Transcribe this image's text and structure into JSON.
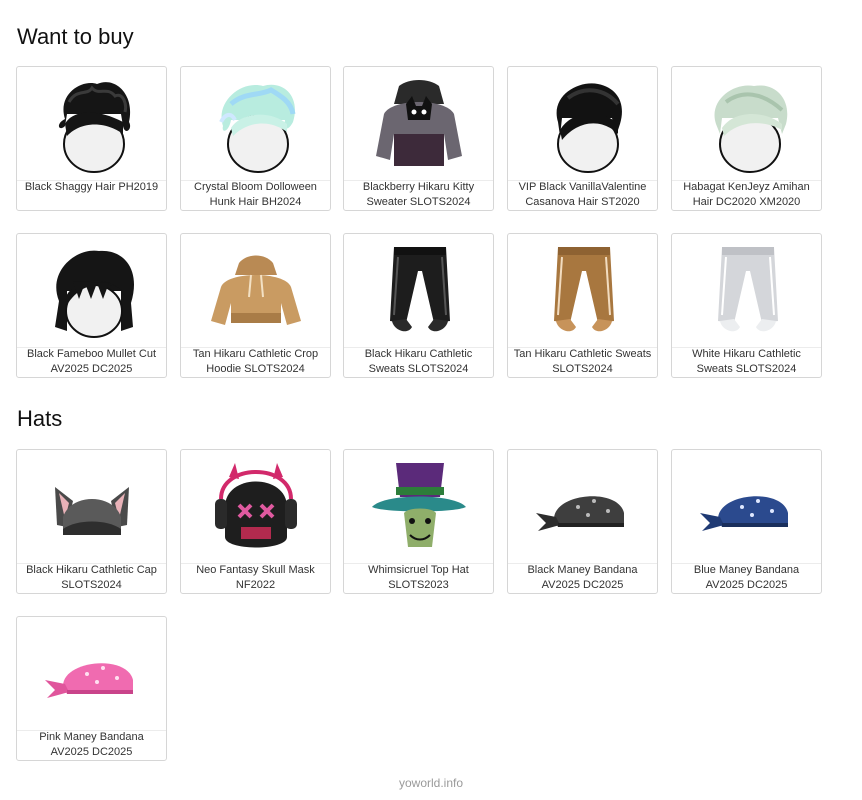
{
  "sections": [
    {
      "title": "Want to buy",
      "items": [
        {
          "name": "Black Shaggy Hair PH2019",
          "icon": "black-shaggy-hair-icon"
        },
        {
          "name": "Crystal Bloom Dolloween Hunk Hair BH2024",
          "icon": "crystal-bloom-hair-icon"
        },
        {
          "name": "Blackberry Hikaru Kitty Sweater SLOTS2024",
          "icon": "kitty-sweater-icon"
        },
        {
          "name": "VIP Black VanillaValentine Casanova Hair ST2020",
          "icon": "casanova-hair-icon"
        },
        {
          "name": "Habagat KenJeyz Amihan Hair DC2020 XM2020",
          "icon": "amihan-hair-icon"
        },
        {
          "name": "Black Fameboo Mullet Cut AV2025 DC2025",
          "icon": "mullet-hair-icon"
        },
        {
          "name": "Tan Hikaru Cathletic Crop Hoodie SLOTS2024",
          "icon": "crop-hoodie-icon"
        },
        {
          "name": "Black Hikaru Cathletic Sweats SLOTS2024",
          "icon": "black-sweats-icon"
        },
        {
          "name": "Tan Hikaru Cathletic Sweats SLOTS2024",
          "icon": "tan-sweats-icon"
        },
        {
          "name": "White Hikaru Cathletic Sweats SLOTS2024",
          "icon": "white-sweats-icon"
        }
      ]
    },
    {
      "title": "Hats",
      "items": [
        {
          "name": "Black Hikaru Cathletic Cap SLOTS2024",
          "icon": "cat-ear-cap-icon"
        },
        {
          "name": "Neo Fantasy Skull Mask NF2022",
          "icon": "skull-mask-icon"
        },
        {
          "name": "Whimsicruel Top Hat SLOTS2023",
          "icon": "top-hat-icon"
        },
        {
          "name": "Black Maney Bandana AV2025 DC2025",
          "icon": "black-bandana-icon"
        },
        {
          "name": "Blue Maney Bandana AV2025 DC2025",
          "icon": "blue-bandana-icon"
        },
        {
          "name": "Pink Maney Bandana AV2025 DC2025",
          "icon": "pink-bandana-icon"
        }
      ]
    }
  ],
  "footer": "yoworld.info",
  "colors": {
    "card_border": "#d6d6d6",
    "footer_text": "#9a9a9a"
  }
}
